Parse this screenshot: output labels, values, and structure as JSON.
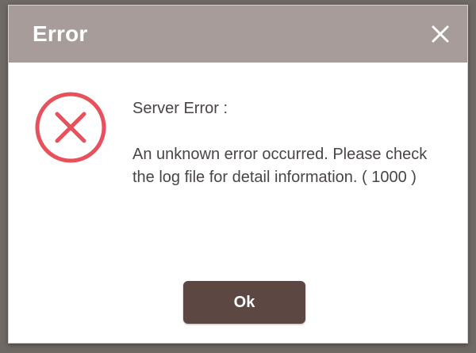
{
  "dialog": {
    "title": "Error",
    "close_icon": "close-icon",
    "status_icon": "error-circle-x-icon",
    "message_heading": "Server Error :",
    "message_body": "An unknown error occurred. Please check the log file for detail information. ( 1000 )",
    "ok_label": "Ok"
  },
  "colors": {
    "titlebar": "#a79c99",
    "error_icon": "#e8505b",
    "ok_button": "#5c4743",
    "text": "#4a4544"
  }
}
